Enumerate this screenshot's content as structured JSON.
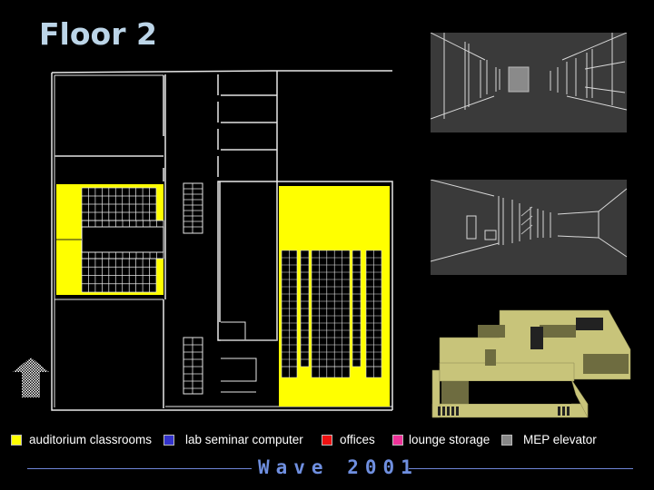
{
  "slide": {
    "title": "Floor 2",
    "footer": "Wave 2001"
  },
  "legend": [
    {
      "label": "auditorium classrooms",
      "color": "#ffff00"
    },
    {
      "label": "lab seminar computer",
      "color": "#3333cc"
    },
    {
      "label": "offices",
      "color": "#ee1111"
    },
    {
      "label": "lounge storage",
      "color": "#ee3399"
    },
    {
      "label": "MEP elevator",
      "color": "#888888"
    }
  ],
  "colors": {
    "background": "#000000",
    "title": "#bcd5e8",
    "footer": "#6f8fe0",
    "plan_walls": "#ffffff",
    "auditorium": "#ffff00",
    "render_bg": "#3a3a3a",
    "model": "#c8c47a"
  },
  "images": {
    "floor_plan": "floor-plan-drawing",
    "corridor_view_1": "corridor-perspective-render",
    "corridor_view_2": "corridor-perspective-render",
    "model_3d": "3d-building-model-render"
  }
}
